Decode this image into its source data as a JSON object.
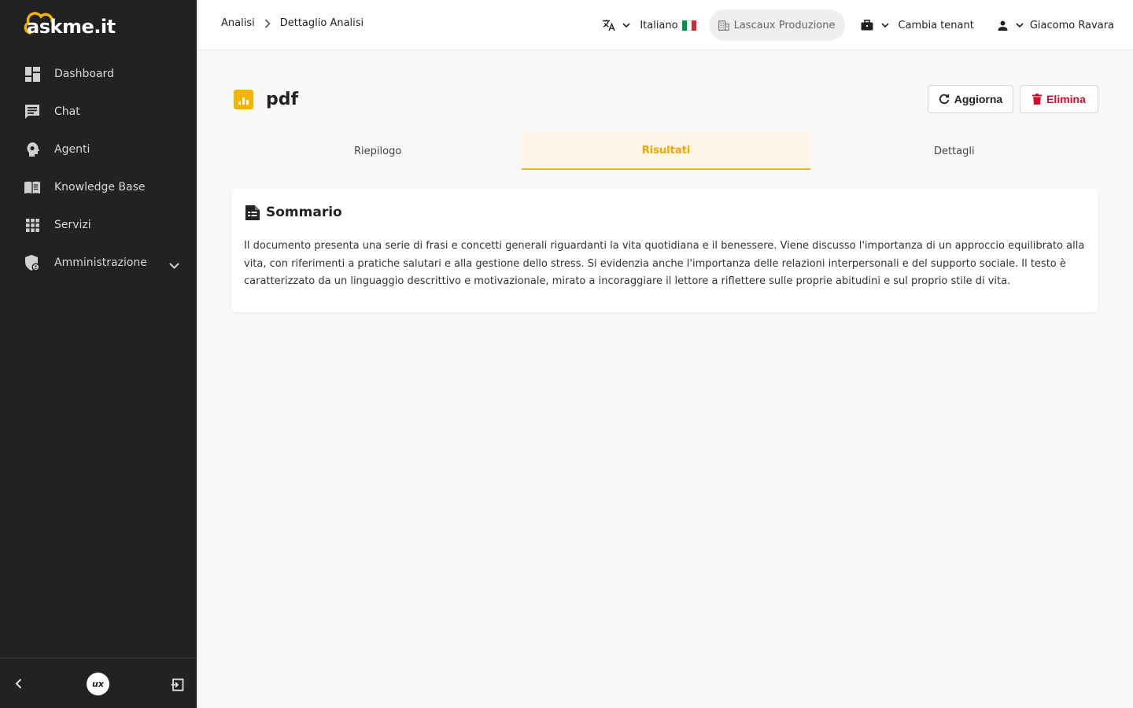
{
  "app": {
    "logo_text": "askme.it"
  },
  "sidebar": {
    "items": [
      {
        "label": "Dashboard",
        "icon": "dashboard-icon"
      },
      {
        "label": "Chat",
        "icon": "chat-icon"
      },
      {
        "label": "Agenti",
        "icon": "agent-icon"
      },
      {
        "label": "Knowledge Base",
        "icon": "book-icon"
      },
      {
        "label": "Servizi",
        "icon": "grid-icon"
      },
      {
        "label": "Amministrazione",
        "icon": "shield-icon",
        "expandable": true
      }
    ],
    "footer": {
      "ux_badge": "ux"
    }
  },
  "header": {
    "breadcrumb": [
      "Analisi",
      "Dettaglio Analisi"
    ],
    "language": "Italiano",
    "tenant": "Lascaux Produzione",
    "change_tenant": "Cambia tenant",
    "user": "Giacomo Ravara"
  },
  "page": {
    "title": "pdf",
    "refresh_label": "Aggiorna",
    "delete_label": "Elimina",
    "tabs": [
      {
        "label": "Riepilogo",
        "active": false
      },
      {
        "label": "Risultati",
        "active": true
      },
      {
        "label": "Dettagli",
        "active": false
      }
    ],
    "summary": {
      "title": "Sommario",
      "text": "Il documento presenta una serie di frasi e concetti generali riguardanti la vita quotidiana e il benessere. Viene discusso l'importanza di un approccio equilibrato alla vita, con riferimenti a pratiche salutari e alla gestione dello stress. Si evidenzia anche l'importanza delle relazioni interpersonali e del supporto sociale. Il testo è caratterizzato da un linguaggio descrittivo e motivazionale, mirato a incoraggiare il lettore a riflettere sulle proprie abitudini e sul proprio stile di vita."
    }
  },
  "colors": {
    "accent": "#f5b400",
    "sidebar_bg": "#222222",
    "danger": "#d0102b"
  }
}
